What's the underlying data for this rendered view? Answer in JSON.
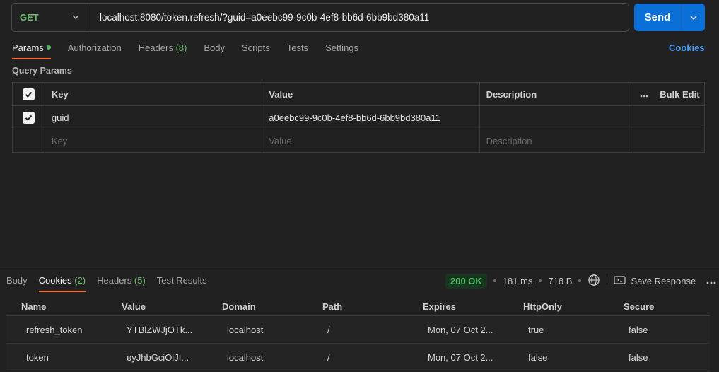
{
  "request": {
    "method": "GET",
    "url": "localhost:8080/token.refresh/?guid=a0eebc99-9c0b-4ef8-bb6d-6bb9bd380a11",
    "send_label": "Send"
  },
  "request_tabs": [
    {
      "label": "Params",
      "active": true,
      "dot": true
    },
    {
      "label": "Authorization"
    },
    {
      "label": "Headers",
      "count": "(8)"
    },
    {
      "label": "Body"
    },
    {
      "label": "Scripts"
    },
    {
      "label": "Tests"
    },
    {
      "label": "Settings"
    }
  ],
  "cookies_link": "Cookies",
  "query_params": {
    "title": "Query Params",
    "headers": {
      "key": "Key",
      "value": "Value",
      "description": "Description",
      "bulk_edit": "Bulk Edit"
    },
    "rows": [
      {
        "checked": true,
        "key": "guid",
        "value": "a0eebc99-9c0b-4ef8-bb6d-6bb9bd380a11",
        "description": ""
      }
    ],
    "placeholders": {
      "key": "Key",
      "value": "Value",
      "description": "Description"
    }
  },
  "response_tabs": [
    {
      "label": "Body"
    },
    {
      "label": "Cookies",
      "count": "(2)",
      "active": true
    },
    {
      "label": "Headers",
      "count": "(5)"
    },
    {
      "label": "Test Results"
    }
  ],
  "response_meta": {
    "status": "200 OK",
    "time": "181 ms",
    "size": "718 B",
    "save_label": "Save Response"
  },
  "cookies": {
    "columns": [
      "Name",
      "Value",
      "Domain",
      "Path",
      "Expires",
      "HttpOnly",
      "Secure"
    ],
    "rows": [
      [
        "refresh_token",
        "YTBlZWJjOTk...",
        "localhost",
        "/",
        "Mon, 07 Oct 2...",
        "true",
        "false"
      ],
      [
        "token",
        "eyJhbGciOiJI...",
        "localhost",
        "/",
        "Mon, 07 Oct 2...",
        "false",
        "false"
      ]
    ]
  },
  "colors": {
    "background": "#212121",
    "accent_tab": "#ff6c37",
    "send_button": "#0b6fd8",
    "method_get": "#6bbd6e",
    "status_ok": "#55c26a"
  }
}
